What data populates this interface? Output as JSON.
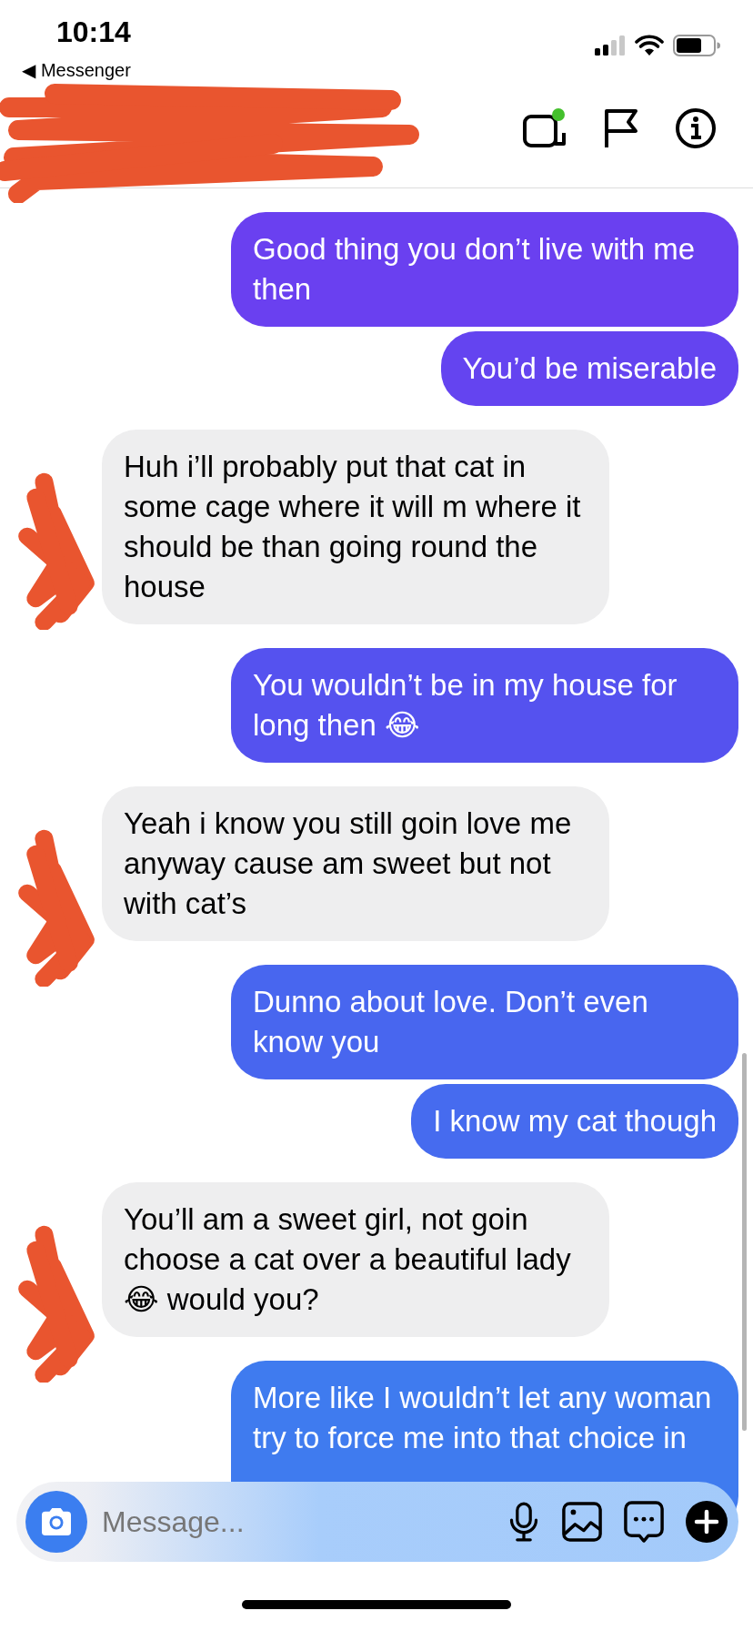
{
  "status_bar": {
    "time": "10:14",
    "back_label": "◀ Messenger"
  },
  "header": {
    "name_redacted": true,
    "video_call_active": true
  },
  "messages": [
    {
      "kind": "sent",
      "text": "Good thing you don’t live with me then",
      "color": "#6a40f0"
    },
    {
      "kind": "sent",
      "text": "You’d be miserable",
      "color": "#6444f0"
    },
    {
      "kind": "received",
      "text": "Huh i’ll probably put that cat in some cage where it will m where it should be than going round the house",
      "avatar_redacted": true
    },
    {
      "kind": "sent",
      "text": "You wouldn’t be in my house for long then 😂",
      "color": "#5552ef"
    },
    {
      "kind": "received",
      "text": "Yeah i know you still goin love me anyway cause am sweet but not with cat’s",
      "avatar_redacted": true
    },
    {
      "kind": "sent",
      "text": "Dunno about love. Don’t even know you",
      "color": "#4866ef"
    },
    {
      "kind": "sent",
      "text": "I know my cat though",
      "color": "#466bef"
    },
    {
      "kind": "received",
      "text": "You’ll am a sweet girl, not goin choose a cat over a beautiful lady 😂 would you?",
      "avatar_redacted": true
    },
    {
      "kind": "sent",
      "text": "More like I wouldn’t let any woman try to force me into that choice in",
      "color": "#3f7bef",
      "cut_off": true
    }
  ],
  "composer": {
    "placeholder": "Message..."
  }
}
